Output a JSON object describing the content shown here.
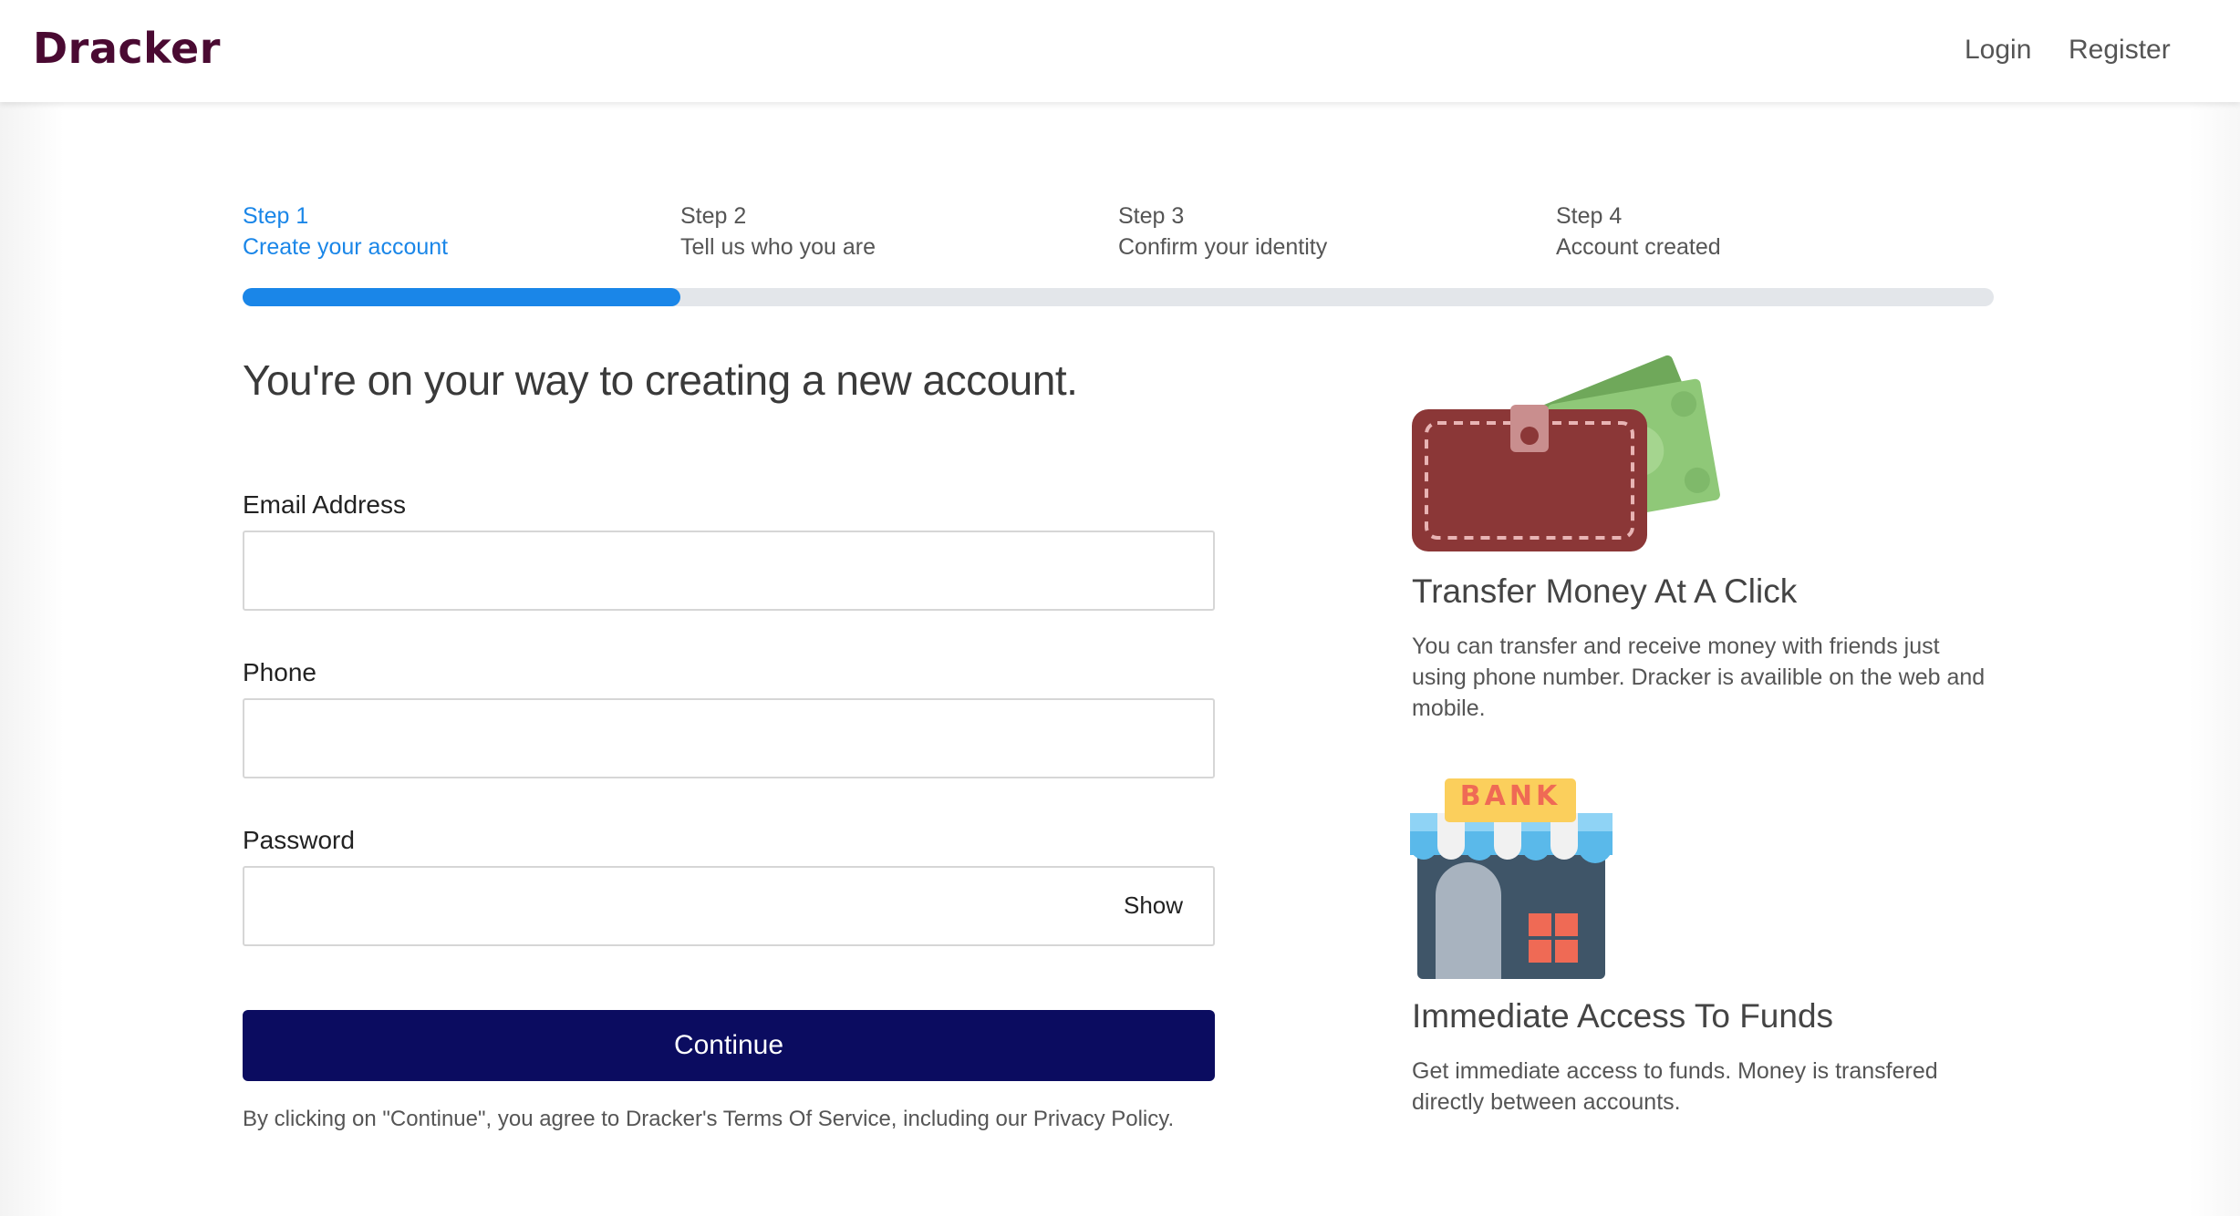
{
  "nav": {
    "brand": "Dracker",
    "login": "Login",
    "register": "Register"
  },
  "steps": [
    {
      "number": "Step 1",
      "title": "Create your account",
      "active": true
    },
    {
      "number": "Step 2",
      "title": "Tell us who you are",
      "active": false
    },
    {
      "number": "Step 3",
      "title": "Confirm your identity",
      "active": false
    },
    {
      "number": "Step 4",
      "title": "Account created",
      "active": false
    }
  ],
  "progress": {
    "fraction": 0.25
  },
  "form": {
    "headline": "You're on your way to creating a new account.",
    "email_label": "Email Address",
    "email_value": "",
    "phone_label": "Phone",
    "phone_value": "",
    "password_label": "Password",
    "password_value": "",
    "show_label": "Show",
    "continue_label": "Continue",
    "terms": "By clicking on \"Continue\", you agree to Dracker's Terms Of Service, including our Privacy Policy."
  },
  "features": [
    {
      "icon": "wallet-money-icon",
      "title": "Transfer Money At A Click",
      "text": "You can transfer and receive money with friends just using phone number. Dracker is availible on the web and mobile."
    },
    {
      "icon": "bank-building-icon",
      "sign": "BANK",
      "title": "Immediate Access To Funds",
      "text": "Get immediate access to funds. Money is transfered directly between accounts."
    }
  ],
  "colors": {
    "brand": "#4a0a32",
    "accent": "#1a86e8",
    "button": "#0b0c60",
    "track": "#e3e6ea"
  }
}
